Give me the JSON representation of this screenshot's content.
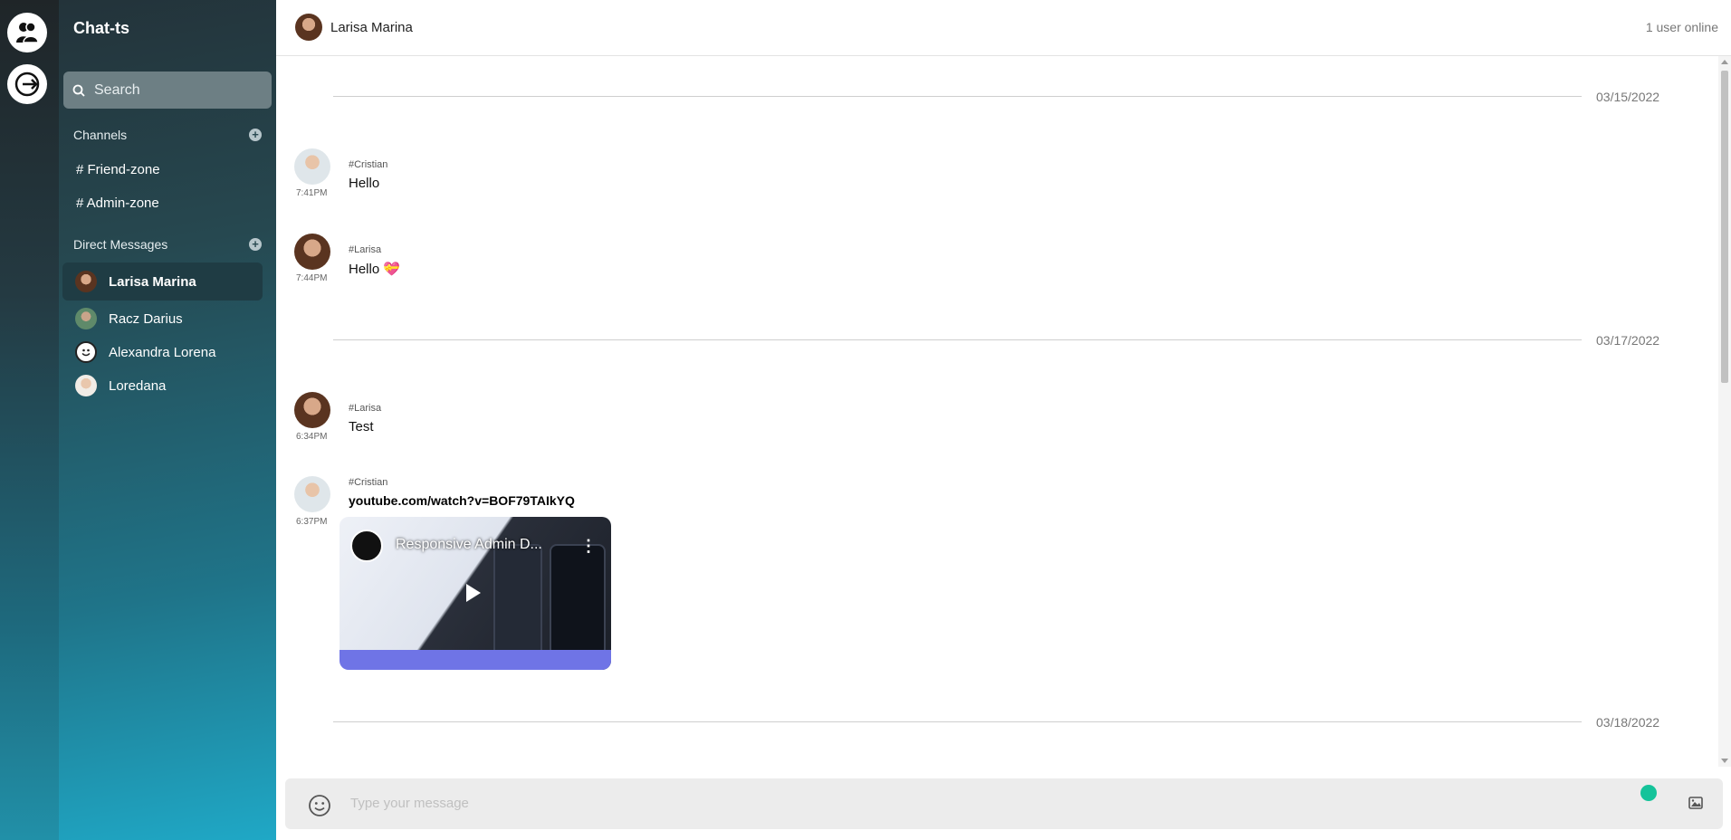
{
  "app": {
    "title": "Chat-ts"
  },
  "rail": {
    "icons": [
      "users-icon",
      "logout-icon"
    ]
  },
  "sidebar": {
    "search_placeholder": "Search",
    "channels_title": "Channels",
    "channels": [
      {
        "label": "# Friend-zone"
      },
      {
        "label": "# Admin-zone"
      }
    ],
    "dm_title": "Direct Messages",
    "direct_messages": [
      {
        "name": "Larisa Marina",
        "active": true
      },
      {
        "name": "Racz Darius",
        "active": false
      },
      {
        "name": "Alexandra Lorena",
        "active": false
      },
      {
        "name": "Loredana",
        "active": false
      }
    ]
  },
  "header": {
    "name": "Larisa Marina",
    "online": "1 user online"
  },
  "dates": [
    "03/15/2022",
    "03/17/2022",
    "03/18/2022"
  ],
  "messages": [
    {
      "user": "#Cristian",
      "time": "7:41PM",
      "text": "Hello"
    },
    {
      "user": "#Larisa",
      "time": "7:44PM",
      "text": "Hello 💝"
    },
    {
      "user": "#Larisa",
      "time": "6:34PM",
      "text": "Test"
    },
    {
      "user": "#Cristian",
      "time": "6:37PM",
      "text": "youtube.com/watch?v=BOF79TAIkYQ",
      "video_title": "Responsive Admin D..."
    }
  ],
  "composer": {
    "placeholder": "Type your message"
  },
  "colors": {
    "accent": "#1fa8c6",
    "sidebar_dark": "#23333a",
    "active_item": "#1f3c44"
  }
}
